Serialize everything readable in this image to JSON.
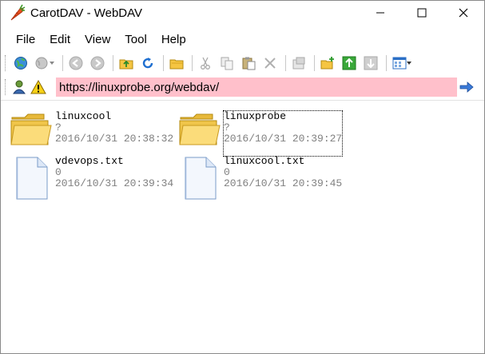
{
  "window": {
    "title": "CarotDAV - WebDAV",
    "icon": "carrot-icon"
  },
  "menu": [
    {
      "label": "File"
    },
    {
      "label": "Edit"
    },
    {
      "label": "View"
    },
    {
      "label": "Tool"
    },
    {
      "label": "Help"
    }
  ],
  "toolbar": {
    "icons": [
      "connect-globe-icon",
      "disconnect-globe-icon",
      "back-icon",
      "forward-icon",
      "up-folder-icon",
      "refresh-icon",
      "open-folder-icon",
      "cut-icon",
      "copy-icon",
      "paste-icon",
      "delete-icon",
      "properties-icon",
      "new-folder-icon",
      "upload-icon",
      "download-icon",
      "view-mode-icon"
    ]
  },
  "address": {
    "url": "https://linuxprobe.org/webdav/",
    "warning_icon": "warning-icon",
    "user_icon": "user-icon",
    "go_icon": "go-arrow-icon",
    "field_color": "#ffc0cb"
  },
  "files": [
    {
      "name": "linuxcool",
      "size": "?",
      "date": "2016/10/31 20:38:32",
      "type": "folder"
    },
    {
      "name": "linuxprobe",
      "size": "?",
      "date": "2016/10/31 20:39:27",
      "type": "folder",
      "selected": true
    },
    {
      "name": "vdevops.txt",
      "size": "0",
      "date": "2016/10/31 20:39:34",
      "type": "file"
    },
    {
      "name": "linuxcool.txt",
      "size": "0",
      "date": "2016/10/31 20:39:45",
      "type": "file"
    }
  ]
}
